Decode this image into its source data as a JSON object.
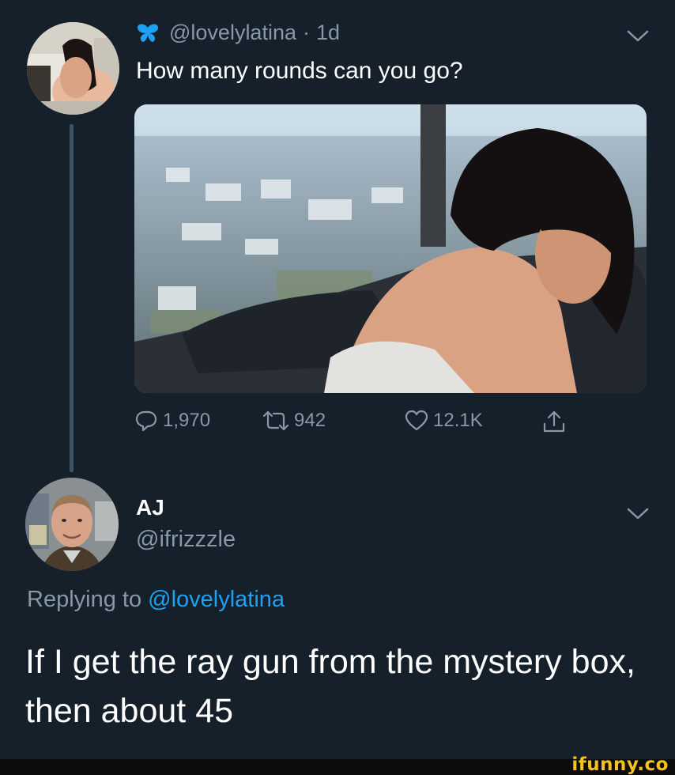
{
  "tweet": {
    "handle": "@lovelylatina",
    "separator": "·",
    "time": "1d",
    "text": "How many rounds can you go?",
    "stats": {
      "replies": "1,970",
      "retweets": "942",
      "likes": "12.1K"
    },
    "icons": [
      "butterfly-icon",
      "chevron-down-icon",
      "reply-icon",
      "retweet-icon",
      "like-icon",
      "share-icon"
    ]
  },
  "reply": {
    "name": "AJ",
    "handle": "@ifrizzzle",
    "replying_prefix": "Replying to ",
    "replying_to": "@lovelylatina",
    "text": "If I get the ray gun from the mystery box, then about 45"
  },
  "footer": {
    "watermark": "ifunny.co"
  },
  "colors": {
    "background": "#15202b",
    "secondary_text": "#8899a6",
    "link": "#1da1f2",
    "thread_line": "#3d5466",
    "watermark": "#f4c21b"
  }
}
